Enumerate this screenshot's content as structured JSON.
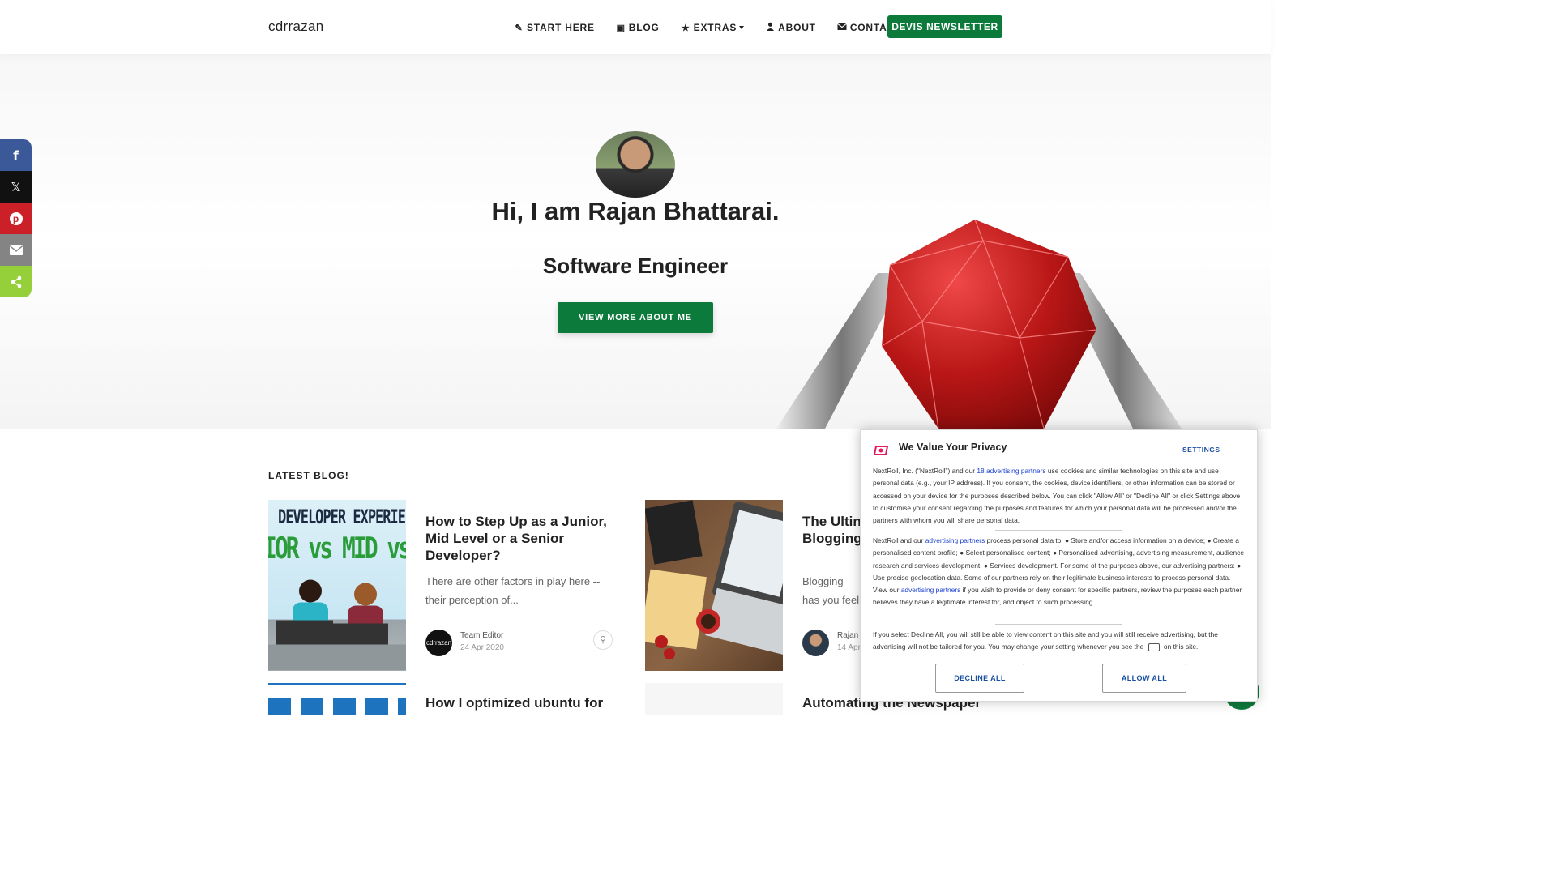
{
  "nav": {
    "brand": "cdrrazan",
    "links": [
      {
        "label": "START HERE",
        "icon": "pencil-icon"
      },
      {
        "label": "BLOG",
        "icon": "square-icon"
      },
      {
        "label": "EXTRAS",
        "icon": "star-icon"
      },
      {
        "label": "ABOUT",
        "icon": "user-icon"
      },
      {
        "label": "CONTACT",
        "icon": "envelope-icon"
      }
    ],
    "newsletter": "DEVIS NEWSLETTER"
  },
  "hero": {
    "title": "Hi, I am Rajan Bhattarai.",
    "subtitle": "Software Engineer",
    "button": "VIEW MORE ABOUT ME"
  },
  "share": [
    {
      "name": "facebook",
      "color": "#3b5998"
    },
    {
      "name": "x",
      "color": "#111111"
    },
    {
      "name": "pinterest",
      "color": "#cb2027"
    },
    {
      "name": "email",
      "color": "#848484"
    },
    {
      "name": "sharethis",
      "color": "#95d03a"
    }
  ],
  "blog": {
    "section_title": "LATEST BLOG!",
    "posts": [
      {
        "title": "How to Step Up as a Junior, Mid Level or a Senior Developer?",
        "excerpt": "There are other factors in play here -- their perception of...",
        "author": "Team Editor",
        "date": "24 Apr 2020",
        "author_avatar_text": "cdrrazan",
        "thumb_text_top": "DEVELOPER EXPERIE",
        "thumb_text_mid": "IOR vs MID vs S"
      },
      {
        "title": "The Ultin Blogging",
        "excerpt": "Blogging has you feel that",
        "author": "Rajan",
        "date": "14 Apr"
      },
      {
        "title": "How I optimized ubuntu for"
      },
      {
        "title": "Automating the Newspaper"
      }
    ]
  },
  "consent": {
    "title": "We Value Your Privacy",
    "settings": "SETTINGS",
    "p1_a": "NextRoll, Inc. (\"NextRoll\") and our ",
    "p1_link": "18 advertising partners",
    "p1_b": " use cookies and similar technologies on this site and use personal data (e.g., your IP address). If you consent, the cookies, device identifiers, or other information can be stored or accessed on your device for the purposes described below. You can click \"Allow All\" or \"Decline All\" or click Settings above to customise your consent regarding the purposes and features for which your personal data will be processed and/or the partners with whom you will share personal data.",
    "p2_a": "NextRoll and our ",
    "p2_link": "advertising partners",
    "p2_b": " process personal data to: ● Store and/or access information on a device; ● Create a personalised content profile; ● Select personalised content; ● Personalised advertising, advertising measurement, audience research and services development; ● Services development. For some of the purposes above, our advertising partners: ● Use precise geolocation data. Some of our partners rely on their legitimate business interests to process personal data. View our ",
    "p2_link2": "advertising partners",
    "p2_c": " if you wish to provide or deny consent for specific partners, review the purposes each partner believes they have a legitimate interest for, and object to such processing.",
    "p3_a": "If you select Decline All, you will still be able to view content on this site and you will still receive advertising, but the advertising will not be tailored for you. You may change your setting whenever you see the ",
    "p3_b": " on this site.",
    "decline": "DECLINE ALL",
    "allow": "ALLOW ALL"
  }
}
